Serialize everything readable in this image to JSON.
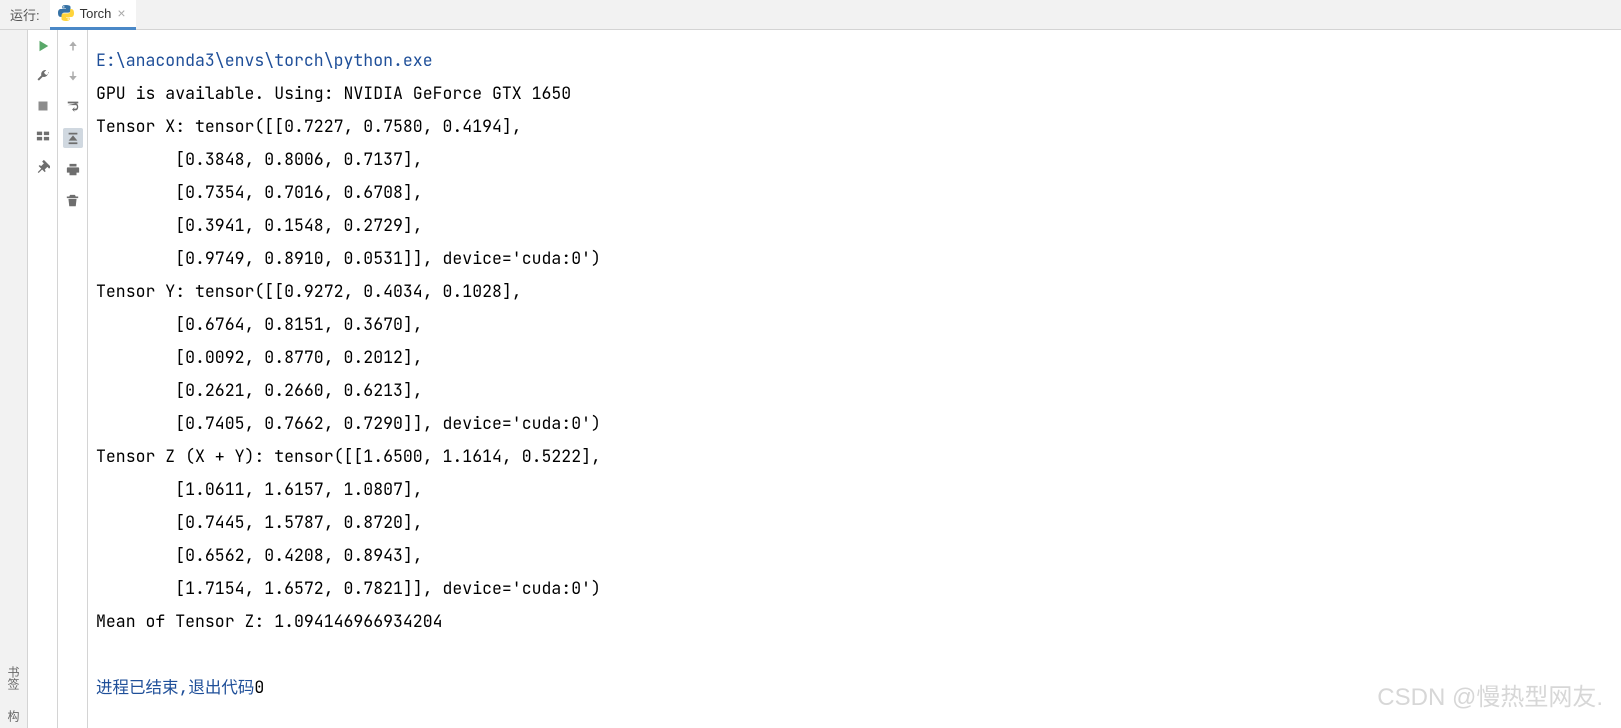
{
  "header": {
    "run_label": "运行:",
    "tab_title": "Torch",
    "tab_close": "×"
  },
  "sidebar": {
    "bookmark_label": "书签",
    "structure_label": "构"
  },
  "console": {
    "path": "E:\\anaconda3\\envs\\torch\\python.exe",
    "lines": [
      "GPU is available. Using: NVIDIA GeForce GTX 1650",
      "Tensor X: tensor([[0.7227, 0.7580, 0.4194],",
      "        [0.3848, 0.8006, 0.7137],",
      "        [0.7354, 0.7016, 0.6708],",
      "        [0.3941, 0.1548, 0.2729],",
      "        [0.9749, 0.8910, 0.0531]], device='cuda:0')",
      "Tensor Y: tensor([[0.9272, 0.4034, 0.1028],",
      "        [0.6764, 0.8151, 0.3670],",
      "        [0.0092, 0.8770, 0.2012],",
      "        [0.2621, 0.2660, 0.6213],",
      "        [0.7405, 0.7662, 0.7290]], device='cuda:0')",
      "Tensor Z (X + Y): tensor([[1.6500, 1.1614, 0.5222],",
      "        [1.0611, 1.6157, 1.0807],",
      "        [0.7445, 1.5787, 0.8720],",
      "        [0.6562, 0.4208, 0.8943],",
      "        [1.7154, 1.6572, 0.7821]], device='cuda:0')",
      "Mean of Tensor Z: 1.094146966934204"
    ],
    "exit_message": "进程已结束,退出代码",
    "exit_code": "0"
  },
  "watermark": "CSDN @慢热型网友."
}
